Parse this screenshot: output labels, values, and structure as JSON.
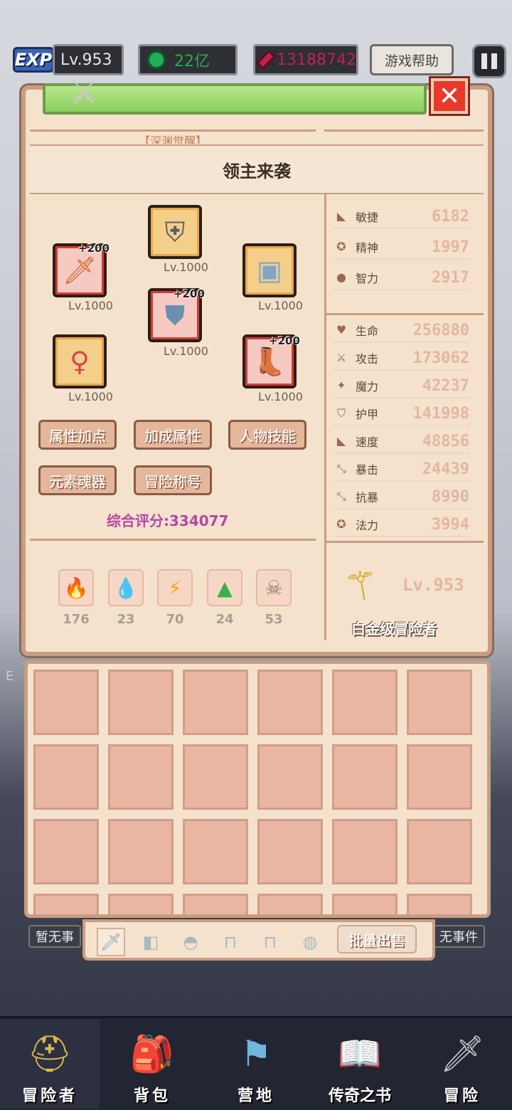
{
  "topbar": {
    "exp_logo": "EXP",
    "level": "Lv.953",
    "green_currency": "22亿",
    "red_currency": "13188742",
    "help_label": "游戏帮助"
  },
  "panel": {
    "subtitle": "【深渊觉醒】",
    "popup_title": "领主来袭",
    "equipment": [
      {
        "name": "weapon",
        "icon": "sword-icon",
        "bonus": "+200",
        "level": "Lv.1000"
      },
      {
        "name": "helmet",
        "icon": "helmet-icon",
        "bonus": "",
        "level": "Lv.1000"
      },
      {
        "name": "chest",
        "icon": "chestplate-icon",
        "bonus": "",
        "level": "Lv.1000"
      },
      {
        "name": "armor",
        "icon": "armor-icon",
        "bonus": "+200",
        "level": "Lv.1000"
      },
      {
        "name": "necklace",
        "icon": "necklace-icon",
        "bonus": "",
        "level": "Lv.1000"
      },
      {
        "name": "boots",
        "icon": "boots-icon",
        "bonus": "+200",
        "level": "Lv.1000"
      }
    ],
    "buttons": {
      "attr_points": "属性加点",
      "bonus_attr": "加成属性",
      "skills": "人物技能",
      "element_soul": "元素魂器",
      "title": "冒险称号"
    },
    "score": "综合评分:334077",
    "elements": [
      {
        "icon": "fire-icon",
        "value": "176"
      },
      {
        "icon": "water-icon",
        "value": "23"
      },
      {
        "icon": "lightning-icon",
        "value": "70"
      },
      {
        "icon": "earth-icon",
        "value": "24"
      },
      {
        "icon": "skull-icon",
        "value": "53"
      }
    ],
    "stats_top": [
      {
        "name": "敏捷",
        "value": "6182"
      },
      {
        "name": "精神",
        "value": "1997"
      },
      {
        "name": "智力",
        "value": "2917"
      }
    ],
    "stats_bottom": [
      {
        "name": "生命",
        "value": "256880"
      },
      {
        "name": "攻击",
        "value": "173062"
      },
      {
        "name": "魔力",
        "value": "42237"
      },
      {
        "name": "护甲",
        "value": "141998"
      },
      {
        "name": "速度",
        "value": "48856"
      },
      {
        "name": "暴击",
        "value": "24439"
      },
      {
        "name": "抗暴",
        "value": "8990"
      },
      {
        "name": "法力",
        "value": "3994"
      }
    ],
    "hero_level": "Lv.953",
    "rank": "白金级冒险者"
  },
  "inventory": {
    "sell_label": "批量出售",
    "left_event": "暂无事",
    "right_event": "无事件"
  },
  "nav": [
    {
      "label": "冒险者",
      "icon": "adventurer-icon"
    },
    {
      "label": "背包",
      "icon": "backpack-icon"
    },
    {
      "label": "营地",
      "icon": "camp-icon"
    },
    {
      "label": "传奇之书",
      "icon": "book-icon"
    },
    {
      "label": "冒险",
      "icon": "adventure-sword-icon"
    }
  ],
  "colors": {
    "accent_green": "#8bcf5e",
    "panel_bg": "#f4e2cc",
    "close_red": "#e8392b",
    "score_purple": "#b348a8"
  }
}
